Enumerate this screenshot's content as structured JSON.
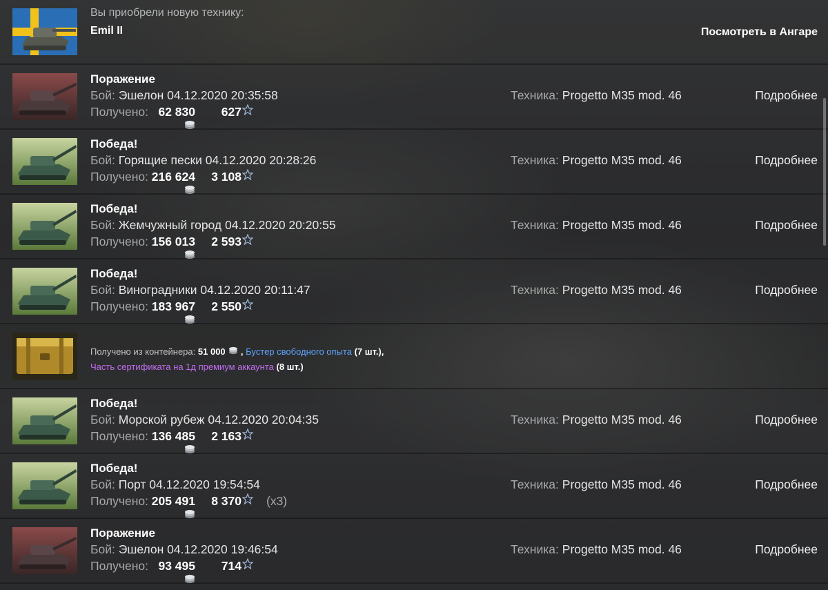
{
  "purchase": {
    "label": "Вы приобрели новую технику:",
    "vehicle": "Emil II",
    "hangar_link": "Посмотреть в Ангаре",
    "flag": "sweden"
  },
  "labels": {
    "battle_prefix": "Бой:",
    "received": "Получено:",
    "vehicle_prefix": "Техника:",
    "details": "Подробнее"
  },
  "battles": [
    {
      "result": "Поражение",
      "outcome": "defeat",
      "map_time": "Эшелон 04.12.2020 20:35:58",
      "credits": "62 830",
      "xp": "627",
      "multiplier": "",
      "vehicle": "Progetto M35 mod. 46"
    },
    {
      "result": "Победа!",
      "outcome": "victory",
      "map_time": "Горящие пески 04.12.2020 20:28:26",
      "credits": "216 624",
      "xp": "3 108",
      "multiplier": "",
      "vehicle": "Progetto M35 mod. 46"
    },
    {
      "result": "Победа!",
      "outcome": "victory",
      "map_time": "Жемчужный город 04.12.2020 20:20:55",
      "credits": "156 013",
      "xp": "2 593",
      "multiplier": "",
      "vehicle": "Progetto M35 mod. 46"
    },
    {
      "result": "Победа!",
      "outcome": "victory",
      "map_time": "Виноградники 04.12.2020 20:11:47",
      "credits": "183 967",
      "xp": "2 550",
      "multiplier": "",
      "vehicle": "Progetto M35 mod. 46"
    },
    {
      "result": "Победа!",
      "outcome": "victory",
      "map_time": "Морской рубеж 04.12.2020 20:04:35",
      "credits": "136 485",
      "xp": "2 163",
      "multiplier": "",
      "vehicle": "Progetto M35 mod. 46"
    },
    {
      "result": "Победа!",
      "outcome": "victory",
      "map_time": "Порт 04.12.2020 19:54:54",
      "credits": "205 491",
      "xp": "8 370",
      "multiplier": "(x3)",
      "vehicle": "Progetto M35 mod. 46"
    },
    {
      "result": "Поражение",
      "outcome": "defeat",
      "map_time": "Эшелон 04.12.2020 19:46:54",
      "credits": "93 495",
      "xp": "714",
      "multiplier": "",
      "vehicle": "Progetto M35 mod. 46"
    }
  ],
  "container": {
    "label": "Получено из контейнера:",
    "credits": "51 000",
    "booster": "Бустер свободного опыта",
    "booster_count": "(7 шт.)",
    "certificate": "Часть сертификата на 1д премиум аккаунта",
    "certificate_count": "(8 шт.)"
  },
  "colors": {
    "booster": "#5ea6ff",
    "certificate": "#c26df0",
    "label_gray": "#a7a9aa",
    "star": "#9fb8d8"
  },
  "icons": {
    "credits": "silver-coin-icon",
    "experience": "star-icon"
  }
}
